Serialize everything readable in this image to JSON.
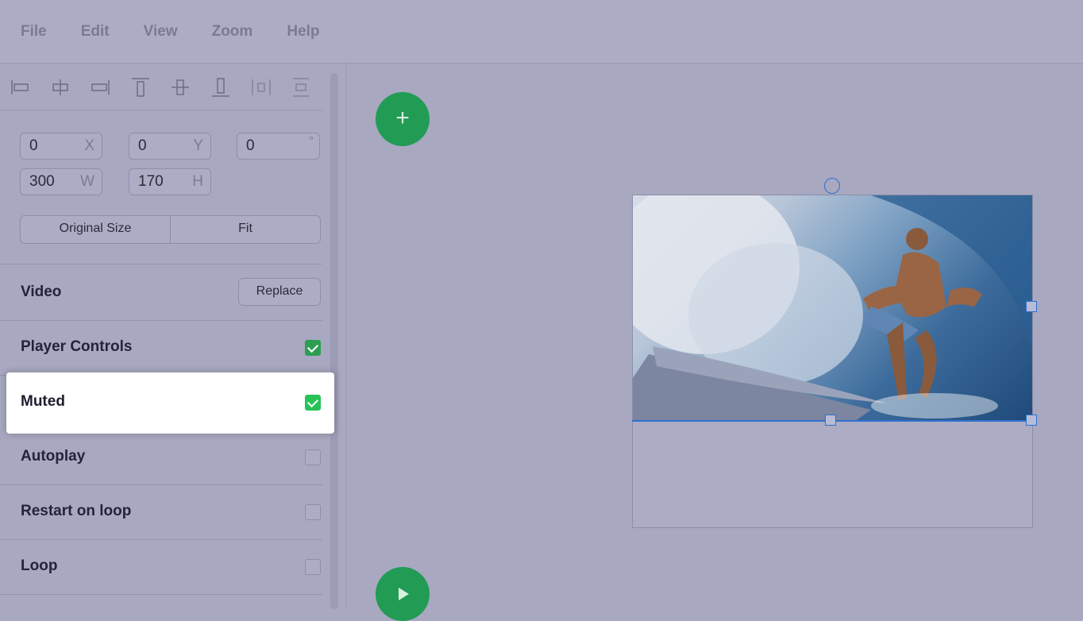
{
  "menu": [
    "File",
    "Edit",
    "View",
    "Zoom",
    "Help"
  ],
  "transform": {
    "x": {
      "value": "0",
      "unit": "X"
    },
    "y": {
      "value": "0",
      "unit": "Y"
    },
    "rotation": {
      "value": "0",
      "unit": "°"
    },
    "w": {
      "value": "300",
      "unit": "W"
    },
    "h": {
      "value": "170",
      "unit": "H"
    }
  },
  "size_buttons": {
    "original": "Original Size",
    "fit": "Fit"
  },
  "video": {
    "label": "Video",
    "replace": "Replace"
  },
  "options": {
    "player_controls": {
      "label": "Player Controls",
      "checked": true
    },
    "muted": {
      "label": "Muted",
      "checked": true
    },
    "autoplay": {
      "label": "Autoplay",
      "checked": false
    },
    "restart_on_loop": {
      "label": "Restart on loop",
      "checked": false
    },
    "loop": {
      "label": "Loop",
      "checked": false
    }
  },
  "add_button": "+",
  "colors": {
    "accent": "#229b55",
    "selection": "#2f6fd0"
  }
}
